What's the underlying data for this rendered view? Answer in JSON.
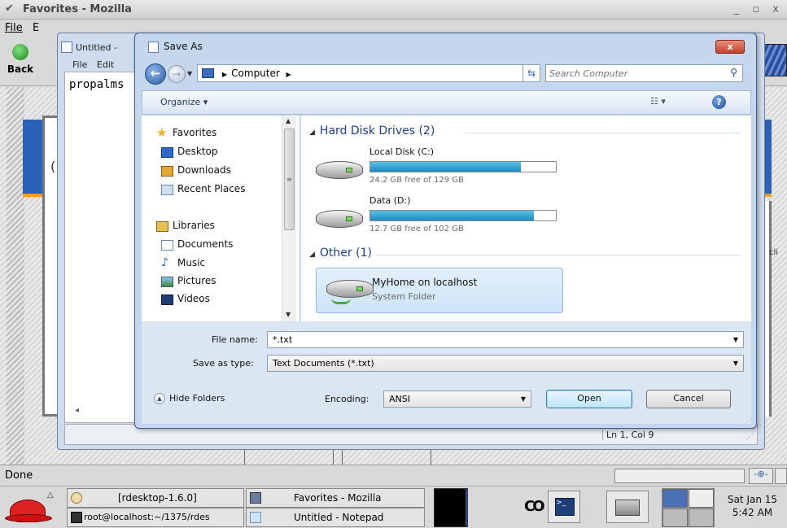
{
  "mozilla": {
    "title": "Favorites - Mozilla",
    "window_buttons": "_ ▫ x",
    "menu": {
      "file": "File",
      "edit_partial": "E"
    },
    "back_label": "Back",
    "content_partial_c": "(",
    "content_partial_cli": "cli",
    "status": "Done"
  },
  "notepad": {
    "title": "Untitled -",
    "menu": [
      "File",
      "Edit"
    ],
    "text": "propalms",
    "status_position": "Ln 1, Col 9"
  },
  "dialog": {
    "title": "Save As",
    "close_label": "x",
    "address": {
      "crumb": "Computer"
    },
    "search_placeholder": "Search Computer",
    "toolbar": {
      "organize": "Organize ▾"
    },
    "nav": {
      "favorites_header": "Favorites",
      "favorites": [
        "Desktop",
        "Downloads",
        "Recent Places"
      ],
      "libraries_header": "Libraries",
      "libraries": [
        "Documents",
        "Music",
        "Pictures",
        "Videos"
      ]
    },
    "groups": {
      "hard_disk_drives": "Hard Disk Drives (2)",
      "other": "Other (1)"
    },
    "drives": [
      {
        "name": "Local Disk (C:)",
        "free": "24.2 GB free of 129 GB",
        "used_fraction": 0.81
      },
      {
        "name": "Data (D:)",
        "free": "12.7 GB free of 102 GB",
        "used_fraction": 0.88
      }
    ],
    "other_item": {
      "name": "MyHome on localhost",
      "type": "System Folder"
    },
    "file_name_label": "File name:",
    "file_name_value": "*.txt",
    "save_type_label": "Save as type:",
    "save_type_value": "Text Documents (*.txt)",
    "hide_folders": "Hide Folders",
    "encoding_label": "Encoding:",
    "encoding_value": "ANSI",
    "open_button": "Open",
    "cancel_button": "Cancel"
  },
  "taskbar": {
    "tasks": [
      {
        "label": "[rdesktop-1.6.0]"
      },
      {
        "label": "Favorites - Mozilla"
      },
      {
        "label": "root@localhost:~/1375/rdes"
      },
      {
        "label": "Untitled - Notepad"
      }
    ],
    "co_icon_text": "CO",
    "clock_day": "Sat Jan 15",
    "clock_time": "5:42 AM"
  },
  "colors": {
    "accent_blue": "#1e3f8c",
    "drive_bar": "#1b8bc0",
    "close_red": "#c4432b"
  },
  "icons": [
    "chevron-down-icon",
    "back-arrow-icon",
    "search-icon",
    "refresh-icon",
    "help-icon",
    "star-icon",
    "desktop-icon",
    "downloads-icon",
    "recent-places-icon",
    "library-icon",
    "documents-icon",
    "music-icon",
    "pictures-icon",
    "videos-icon",
    "hard-drive-icon",
    "network-drive-icon",
    "redhat-icon",
    "terminal-icon",
    "printer-icon"
  ]
}
